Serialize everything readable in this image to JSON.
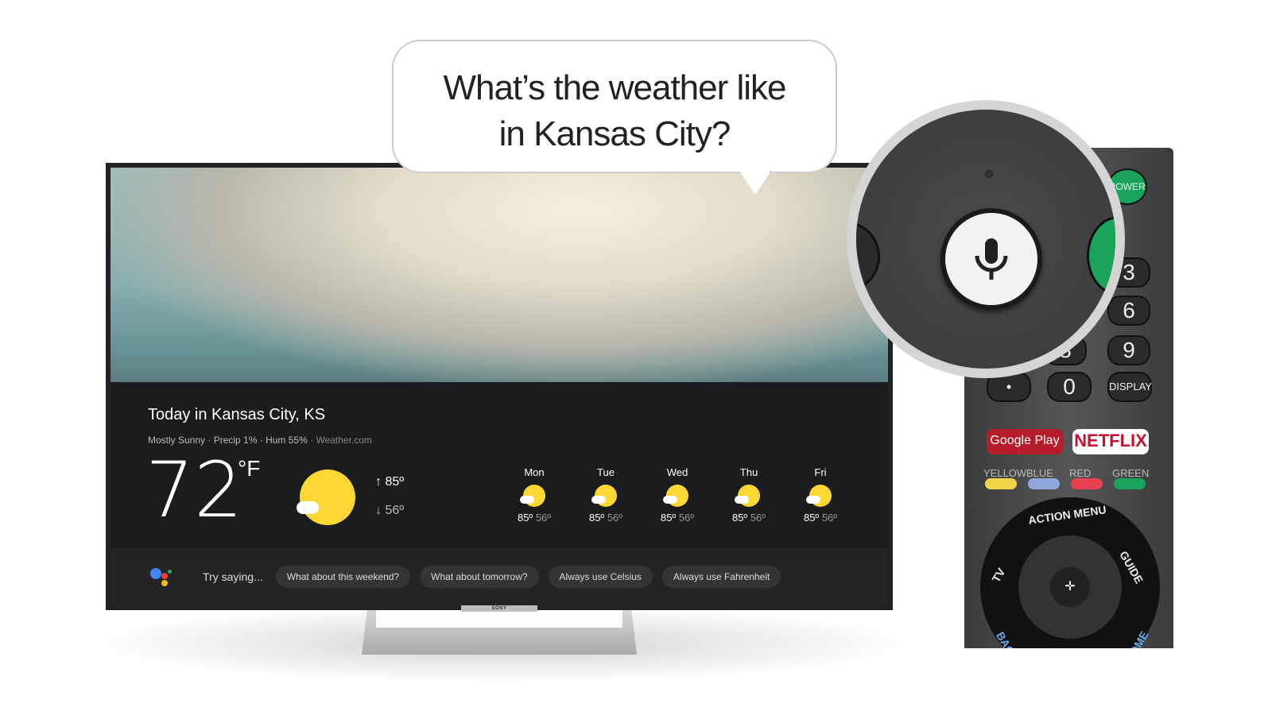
{
  "bubble": {
    "line1": "What’s the weather like",
    "line2": "in Kansas City?"
  },
  "weather": {
    "title": "Today in Kansas City, KS",
    "condition": "Mostly Sunny",
    "precip": "· Precip 1%",
    "humidity": "· Hum 55%",
    "source": "· Weather.com",
    "temp": "72",
    "unit": "°F",
    "high": "↑  85º",
    "low": "↓  56º",
    "forecast": [
      {
        "day": "Mon",
        "high": "85º",
        "low": "56º"
      },
      {
        "day": "Tue",
        "high": "85º",
        "low": "56º"
      },
      {
        "day": "Wed",
        "high": "85º",
        "low": "56º"
      },
      {
        "day": "Thu",
        "high": "85º",
        "low": "56º"
      },
      {
        "day": "Fri",
        "high": "85º",
        "low": "56º"
      }
    ]
  },
  "assistant": {
    "try_label": "Try saying...",
    "chips": [
      "What about this weekend?",
      "What about tomorrow?",
      "Always use Celsius",
      "Always use Fahrenheit"
    ]
  },
  "tv_brand": "SONY",
  "remote": {
    "power": "POWER",
    "keys": [
      "3",
      "6",
      "8",
      "9",
      "•",
      "0",
      "DISPLAY"
    ],
    "google_play": "Google Play",
    "netflix": "NETFLIX",
    "colors": [
      {
        "label": "YELLOW",
        "hex": "#f2d44a"
      },
      {
        "label": "BLUE",
        "hex": "#8ea8dc"
      },
      {
        "label": "RED",
        "hex": "#e8414f"
      },
      {
        "label": "GREEN",
        "hex": "#1aa35a"
      }
    ],
    "action_menu": "ACTION MENU",
    "tv": "TV",
    "guide": "GUIDE",
    "back": "BACK",
    "home": "HOME"
  },
  "icons": {
    "mic": "microphone-icon",
    "assistant": "google-assistant-icon",
    "weather": "partly-sunny-icon"
  }
}
